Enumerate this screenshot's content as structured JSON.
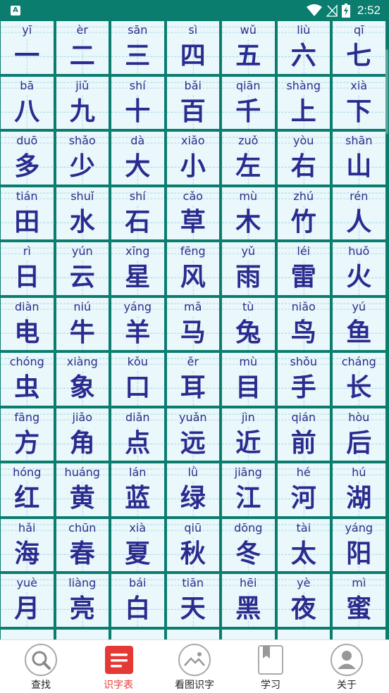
{
  "status_bar": {
    "time": "2:52",
    "badge": "A"
  },
  "characters": [
    {
      "pinyin": "yī",
      "hanzi": "一"
    },
    {
      "pinyin": "èr",
      "hanzi": "二"
    },
    {
      "pinyin": "sān",
      "hanzi": "三"
    },
    {
      "pinyin": "sì",
      "hanzi": "四"
    },
    {
      "pinyin": "wǔ",
      "hanzi": "五"
    },
    {
      "pinyin": "liù",
      "hanzi": "六"
    },
    {
      "pinyin": "qī",
      "hanzi": "七"
    },
    {
      "pinyin": "bā",
      "hanzi": "八"
    },
    {
      "pinyin": "jiǔ",
      "hanzi": "九"
    },
    {
      "pinyin": "shí",
      "hanzi": "十"
    },
    {
      "pinyin": "bǎi",
      "hanzi": "百"
    },
    {
      "pinyin": "qiān",
      "hanzi": "千"
    },
    {
      "pinyin": "shàng",
      "hanzi": "上"
    },
    {
      "pinyin": "xià",
      "hanzi": "下"
    },
    {
      "pinyin": "duō",
      "hanzi": "多"
    },
    {
      "pinyin": "shǎo",
      "hanzi": "少"
    },
    {
      "pinyin": "dà",
      "hanzi": "大"
    },
    {
      "pinyin": "xiǎo",
      "hanzi": "小"
    },
    {
      "pinyin": "zuǒ",
      "hanzi": "左"
    },
    {
      "pinyin": "yòu",
      "hanzi": "右"
    },
    {
      "pinyin": "shān",
      "hanzi": "山"
    },
    {
      "pinyin": "tián",
      "hanzi": "田"
    },
    {
      "pinyin": "shuǐ",
      "hanzi": "水"
    },
    {
      "pinyin": "shí",
      "hanzi": "石"
    },
    {
      "pinyin": "cǎo",
      "hanzi": "草"
    },
    {
      "pinyin": "mù",
      "hanzi": "木"
    },
    {
      "pinyin": "zhú",
      "hanzi": "竹"
    },
    {
      "pinyin": "rén",
      "hanzi": "人"
    },
    {
      "pinyin": "rì",
      "hanzi": "日"
    },
    {
      "pinyin": "yún",
      "hanzi": "云"
    },
    {
      "pinyin": "xīng",
      "hanzi": "星"
    },
    {
      "pinyin": "fēng",
      "hanzi": "风"
    },
    {
      "pinyin": "yǔ",
      "hanzi": "雨"
    },
    {
      "pinyin": "léi",
      "hanzi": "雷"
    },
    {
      "pinyin": "huǒ",
      "hanzi": "火"
    },
    {
      "pinyin": "diàn",
      "hanzi": "电"
    },
    {
      "pinyin": "niú",
      "hanzi": "牛"
    },
    {
      "pinyin": "yáng",
      "hanzi": "羊"
    },
    {
      "pinyin": "mǎ",
      "hanzi": "马"
    },
    {
      "pinyin": "tù",
      "hanzi": "兔"
    },
    {
      "pinyin": "niǎo",
      "hanzi": "鸟"
    },
    {
      "pinyin": "yú",
      "hanzi": "鱼"
    },
    {
      "pinyin": "chóng",
      "hanzi": "虫"
    },
    {
      "pinyin": "xiàng",
      "hanzi": "象"
    },
    {
      "pinyin": "kǒu",
      "hanzi": "口"
    },
    {
      "pinyin": "ěr",
      "hanzi": "耳"
    },
    {
      "pinyin": "mù",
      "hanzi": "目"
    },
    {
      "pinyin": "shǒu",
      "hanzi": "手"
    },
    {
      "pinyin": "cháng",
      "hanzi": "长"
    },
    {
      "pinyin": "fāng",
      "hanzi": "方"
    },
    {
      "pinyin": "jiǎo",
      "hanzi": "角"
    },
    {
      "pinyin": "diǎn",
      "hanzi": "点"
    },
    {
      "pinyin": "yuǎn",
      "hanzi": "远"
    },
    {
      "pinyin": "jìn",
      "hanzi": "近"
    },
    {
      "pinyin": "qián",
      "hanzi": "前"
    },
    {
      "pinyin": "hòu",
      "hanzi": "后"
    },
    {
      "pinyin": "hóng",
      "hanzi": "红"
    },
    {
      "pinyin": "huáng",
      "hanzi": "黄"
    },
    {
      "pinyin": "lán",
      "hanzi": "蓝"
    },
    {
      "pinyin": "lǜ",
      "hanzi": "绿"
    },
    {
      "pinyin": "jiāng",
      "hanzi": "江"
    },
    {
      "pinyin": "hé",
      "hanzi": "河"
    },
    {
      "pinyin": "hú",
      "hanzi": "湖"
    },
    {
      "pinyin": "hǎi",
      "hanzi": "海"
    },
    {
      "pinyin": "chūn",
      "hanzi": "春"
    },
    {
      "pinyin": "xià",
      "hanzi": "夏"
    },
    {
      "pinyin": "qiū",
      "hanzi": "秋"
    },
    {
      "pinyin": "dōng",
      "hanzi": "冬"
    },
    {
      "pinyin": "tài",
      "hanzi": "太"
    },
    {
      "pinyin": "yáng",
      "hanzi": "阳"
    },
    {
      "pinyin": "yuè",
      "hanzi": "月"
    },
    {
      "pinyin": "liàng",
      "hanzi": "亮"
    },
    {
      "pinyin": "bái",
      "hanzi": "白"
    },
    {
      "pinyin": "tiān",
      "hanzi": "天"
    },
    {
      "pinyin": "hēi",
      "hanzi": "黑"
    },
    {
      "pinyin": "yè",
      "hanzi": "夜"
    },
    {
      "pinyin": "mì",
      "hanzi": "蜜"
    }
  ],
  "nav": [
    {
      "label": "查找",
      "icon": "search-icon"
    },
    {
      "label": "识字表",
      "icon": "list-icon"
    },
    {
      "label": "看图识字",
      "icon": "picture-icon"
    },
    {
      "label": "学习",
      "icon": "book-icon"
    },
    {
      "label": "关于",
      "icon": "user-icon"
    }
  ],
  "colors": {
    "primary": "#0a7d6f",
    "cell_bg": "#eaf7fb",
    "hanzi": "#2b2b8f",
    "active": "#e53935"
  }
}
